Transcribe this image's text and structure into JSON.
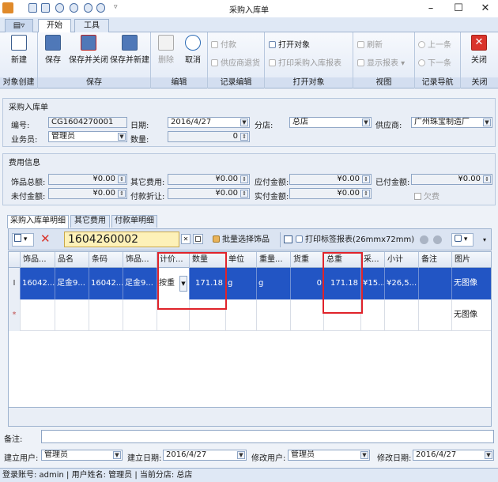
{
  "window": {
    "title": "采购入库单",
    "minimize": "–",
    "maximize": "☐",
    "close": "✕"
  },
  "ribbon_tabs": [
    "开始",
    "工具"
  ],
  "ribbon": {
    "groups": [
      "对象创建",
      "保存",
      "编辑",
      "记录编辑",
      "打开对象",
      "视图",
      "记录导航",
      "关闭"
    ],
    "new": "新建",
    "save": "保存",
    "save_close": "保存并关闭",
    "save_new": "保存并新建",
    "delete": "删除",
    "cancel": "取消",
    "pay": "付款",
    "supplier_return": "供应商退货",
    "open_object": "打开对象",
    "print_report": "打印采购入库报表",
    "refresh": "刷新",
    "show_report": "显示报表",
    "prev": "上一条",
    "next": "下一条",
    "close": "关闭"
  },
  "form": {
    "section_title": "采购入库单",
    "number_label": "编号:",
    "number": "CG1604270001",
    "date_label": "日期:",
    "date": "2016/4/27",
    "branch_label": "分店:",
    "branch": "总店",
    "supplier_label": "供应商:",
    "supplier": "广州珠宝制造厂",
    "clerk_label": "业务员:",
    "clerk": "管理员",
    "qty_label": "数量:",
    "qty": "0"
  },
  "fees": {
    "section_title": "费用信息",
    "total_label": "饰品总额:",
    "total": "¥0.00",
    "other_label": "其它费用:",
    "other": "¥0.00",
    "payable_label": "应付金额:",
    "payable": "¥0.00",
    "paid_label": "已付金额:",
    "paid": "¥0.00",
    "unpaid_label": "未付金额:",
    "unpaid": "¥0.00",
    "discount_label": "付款折让:",
    "discount": "¥0.00",
    "actual_label": "实付金额:",
    "actual": "¥0.00",
    "owe_label": "欠费"
  },
  "detail_tabs": [
    "采购入库单明细",
    "其它费用",
    "付款单明细"
  ],
  "grid_toolbar": {
    "search_value": "1604260002",
    "batch_select": "批量选择饰品",
    "print_tags": "打印标签报表(26mmx72mm)"
  },
  "grid": {
    "columns": [
      "饰品...",
      "品名",
      "条码",
      "饰品...",
      "计价...",
      "数量",
      "单位",
      "重量...",
      "货重",
      "总重",
      "采...",
      "小计",
      "备注",
      "图片"
    ],
    "rows": [
      [
        "16042...",
        "足金9...",
        "16042...",
        "足金9...",
        "按重",
        "171.18",
        "g",
        "g",
        "0",
        "171.18",
        "¥15...",
        "¥26,5...",
        "",
        "无图像"
      ],
      [
        "",
        "",
        "",
        "",
        "",
        "",
        "",
        "",
        "",
        "",
        "",
        "",
        "",
        "无图像"
      ]
    ],
    "row_markers": [
      "I",
      "*"
    ]
  },
  "footer": {
    "remark_label": "备注:",
    "remark": "",
    "creator_label": "建立用户:",
    "creator": "管理员",
    "created_label": "建立日期:",
    "created": "2016/4/27",
    "modifier_label": "修改用户:",
    "modifier": "管理员",
    "modified_label": "修改日期:",
    "modified": "2016/4/27"
  },
  "status": {
    "text": "登录账号: admin | 用户姓名: 管理员 | 当前分店: 总店"
  },
  "colors": {
    "selected_row": "#2255c4",
    "highlight": "#e0232a",
    "accent": "#2c4f82"
  }
}
